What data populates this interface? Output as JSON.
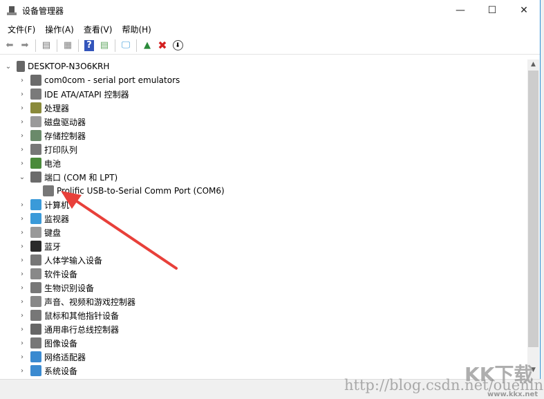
{
  "window": {
    "title": "设备管理器",
    "minimize": "—",
    "maximize": "☐",
    "close": "✕"
  },
  "menu": [
    "文件(F)",
    "操作(A)",
    "查看(V)",
    "帮助(H)"
  ],
  "toolbar": [
    "back",
    "forward",
    "show-hide-console-tree",
    "properties",
    "help",
    "view",
    "scan-hardware",
    "update-driver",
    "uninstall",
    "disable"
  ],
  "tree": {
    "root": "DESKTOP-N3O6KRH",
    "items": [
      {
        "label": "com0com - serial port emulators",
        "color": "#6b6b6b"
      },
      {
        "label": "IDE ATA/ATAPI 控制器",
        "color": "#7a7a7a"
      },
      {
        "label": "处理器",
        "color": "#8a8a3a"
      },
      {
        "label": "磁盘驱动器",
        "color": "#9a9a9a"
      },
      {
        "label": "存储控制器",
        "color": "#6a8a6a"
      },
      {
        "label": "打印队列",
        "color": "#777"
      },
      {
        "label": "电池",
        "color": "#4a8a3a"
      },
      {
        "label": "端口 (COM 和 LPT)",
        "color": "#6b6b6b",
        "expanded": true
      },
      {
        "label": "Prolific USB-to-Serial Comm Port (COM6)",
        "color": "#777",
        "child": true
      },
      {
        "label": "计算机",
        "color": "#3a9ad9"
      },
      {
        "label": "监视器",
        "color": "#3a9ad9"
      },
      {
        "label": "键盘",
        "color": "#999"
      },
      {
        "label": "蓝牙",
        "color": "#2a2a2a"
      },
      {
        "label": "人体学输入设备",
        "color": "#777"
      },
      {
        "label": "软件设备",
        "color": "#888"
      },
      {
        "label": "生物识别设备",
        "color": "#777"
      },
      {
        "label": "声音、视频和游戏控制器",
        "color": "#888"
      },
      {
        "label": "鼠标和其他指针设备",
        "color": "#777"
      },
      {
        "label": "通用串行总线控制器",
        "color": "#666"
      },
      {
        "label": "图像设备",
        "color": "#777"
      },
      {
        "label": "网络适配器",
        "color": "#3a8ad0"
      },
      {
        "label": "系统设备",
        "color": "#3a8ad0"
      }
    ]
  },
  "watermark": {
    "url": "http://blog.csdn.net/ouening",
    "logo": "KK下载",
    "site": "www.kkx.net"
  },
  "arrow_color": "#e8403a"
}
